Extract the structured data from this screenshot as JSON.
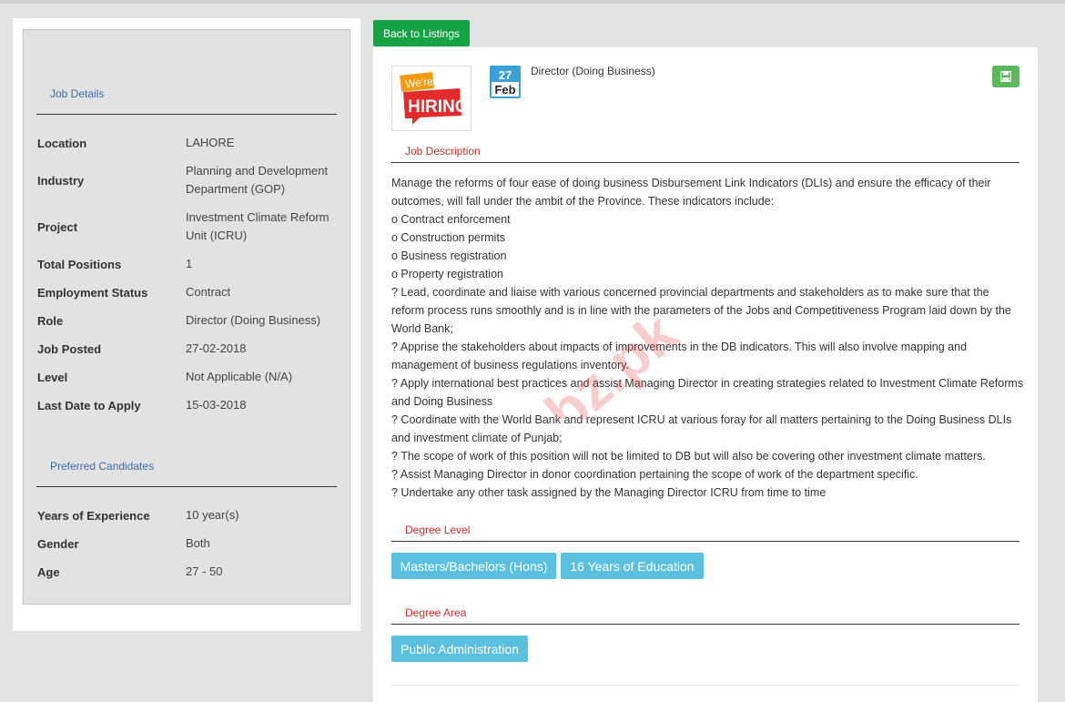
{
  "left": {
    "job_details_heading": "Job Details",
    "details": [
      {
        "label": "Location",
        "value": "LAHORE"
      },
      {
        "label": "Industry",
        "value": "Planning and Development Department (GOP)"
      },
      {
        "label": "Project",
        "value": "Investment Climate Reform Unit (ICRU)"
      },
      {
        "label": "Total Positions",
        "value": "1"
      },
      {
        "label": "Employment Status",
        "value": "Contract"
      },
      {
        "label": "Role",
        "value": "Director (Doing Business)"
      },
      {
        "label": "Job Posted",
        "value": "27-02-2018"
      },
      {
        "label": "Level",
        "value": "Not Applicable (N/A)"
      },
      {
        "label": "Last Date to Apply",
        "value": "15-03-2018"
      }
    ],
    "preferred_heading": "Preferred Candidates",
    "preferred": [
      {
        "label": "Years of Experience",
        "value": "10 year(s)"
      },
      {
        "label": "Gender",
        "value": "Both"
      },
      {
        "label": "Age",
        "value": "27 - 50"
      }
    ]
  },
  "back_button_label": "Back to Listings",
  "job": {
    "logo": {
      "line1": "We're",
      "line2": "HIRING"
    },
    "date_day": "27",
    "date_month": "Feb",
    "title": "Director (Doing Business)",
    "save_icon": "floppy-disk-icon"
  },
  "description": {
    "heading": "Job Description",
    "lines": [
      "Manage the reforms of four ease of doing business Disbursement Link Indicators (DLIs) and ensure the efficacy of their outcomes, will fall under the ambit of the Province. These indicators include:",
      "o Contract enforcement",
      "o Construction permits",
      "o Business registration",
      "o Property registration",
      "? Lead, coordinate and liaise with various concerned provincial departments and stakeholders as to make sure that the reform process runs smoothly and is in line with the parameters of the Jobs and Competitiveness Program laid down by the World Bank;",
      "? Apprise the stakeholders about impacts of improvements in the DB indicators. This will also involve mapping and management of business regulations inventory.",
      "? Apply international best practices and assist Managing Director in creating strategies related to Investment Climate Reforms and Doing Business",
      "? Coordinate with the World Bank and represent ICRU at various foray for all matters pertaining to the Doing Business DLIs and investment climate of Punjab;",
      "? The scope of work of this position will not be limited to DB but will also be covering other investment climate matters.",
      "? Assist Managing Director in donor coordination pertaining the scope of work of the department specific.",
      "? Undertake any other task assigned by the Managing Director ICRU from time to time"
    ]
  },
  "degree_level": {
    "heading": "Degree Level",
    "items": [
      "Masters/Bachelors (Hons)",
      "16 Years of Education"
    ]
  },
  "degree_area": {
    "heading": "Degree Area",
    "items": [
      "Public Administration"
    ]
  },
  "watermark": "Jobz.pk",
  "colors": {
    "accent_green": "#16a345",
    "pill_blue": "#5bc0de",
    "section_red": "#c9302c",
    "heading_blue": "#3a6ea5"
  }
}
